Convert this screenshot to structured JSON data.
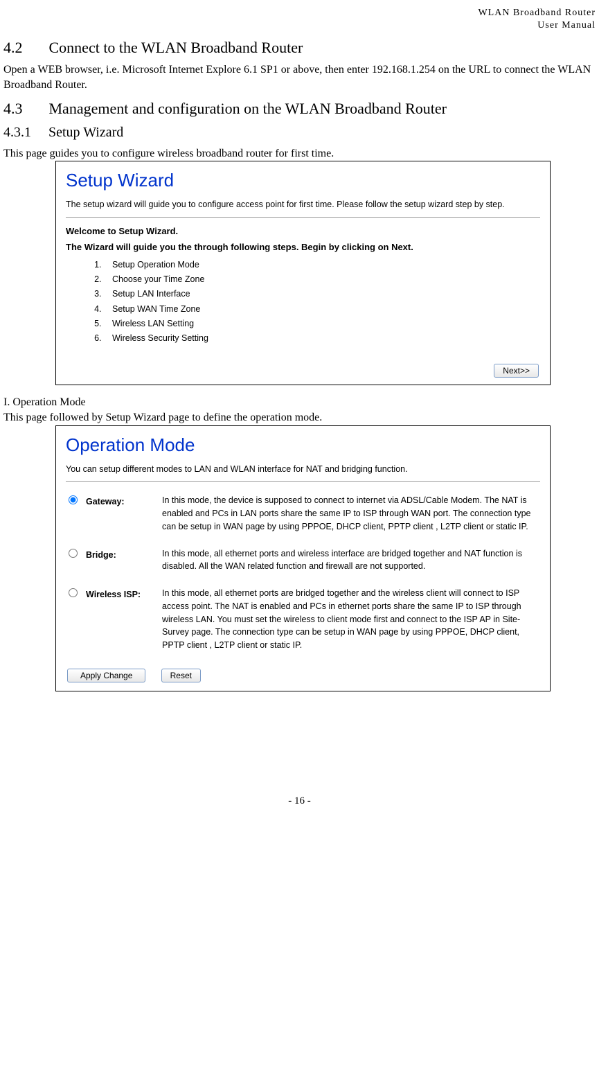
{
  "header": {
    "line1": "WLAN  Broadband  Router",
    "line2": "User  Manual"
  },
  "section42": {
    "number": "4.2",
    "title": "Connect to the WLAN Broadband Router",
    "body": "Open a WEB browser, i.e. Microsoft Internet Explore 6.1 SP1 or above, then enter 192.168.1.254 on the URL to connect the WLAN Broadband Router."
  },
  "section43": {
    "number": "4.3",
    "title": "Management and configuration on the WLAN Broadband Router"
  },
  "section431": {
    "number": "4.3.1",
    "title": "Setup Wizard",
    "intro": "This page guides you to configure wireless broadband router for first time."
  },
  "setupWizard": {
    "title": "Setup Wizard",
    "desc": "The setup wizard will guide you to configure access point for first time. Please follow the setup wizard step by step.",
    "welcome": "Welcome to Setup Wizard.",
    "instruction": "The Wizard will guide you the through following steps. Begin by clicking on Next.",
    "steps": [
      "Setup Operation Mode",
      "Choose your Time Zone",
      "Setup LAN Interface",
      "Setup WAN Time Zone",
      "Wireless LAN Setting",
      "Wireless Security Setting"
    ],
    "nextBtn": "Next>>"
  },
  "opModeSection": {
    "heading": "I. Operation Mode",
    "intro": "This page followed by Setup Wizard page to define the operation mode."
  },
  "operationMode": {
    "title": "Operation Mode",
    "desc": "You can setup different modes to LAN and WLAN interface for NAT and bridging function.",
    "options": [
      {
        "label": "Gateway:",
        "checked": true,
        "text": "In this mode, the device is supposed to connect to internet via ADSL/Cable Modem. The NAT is enabled and PCs in LAN ports share the same IP to ISP through WAN port. The connection type can be setup in WAN page by using PPPOE, DHCP client, PPTP client , L2TP client or static IP."
      },
      {
        "label": "Bridge:",
        "checked": false,
        "text": "In this mode, all ethernet ports and wireless interface are bridged together and NAT function is disabled. All the WAN related function and firewall are not supported."
      },
      {
        "label": "Wireless ISP:",
        "checked": false,
        "text": "In this mode, all ethernet ports are bridged together and the wireless client will connect to ISP access point. The NAT is enabled and PCs in ethernet ports share the same IP to ISP through wireless LAN. You must set the wireless to client mode first and connect to the ISP AP in Site-Survey page. The connection type can be setup in WAN page by using PPPOE, DHCP client, PPTP client , L2TP client or static IP."
      }
    ],
    "applyBtn": "Apply Change",
    "resetBtn": "Reset"
  },
  "footer": {
    "page": "- 16 -"
  }
}
